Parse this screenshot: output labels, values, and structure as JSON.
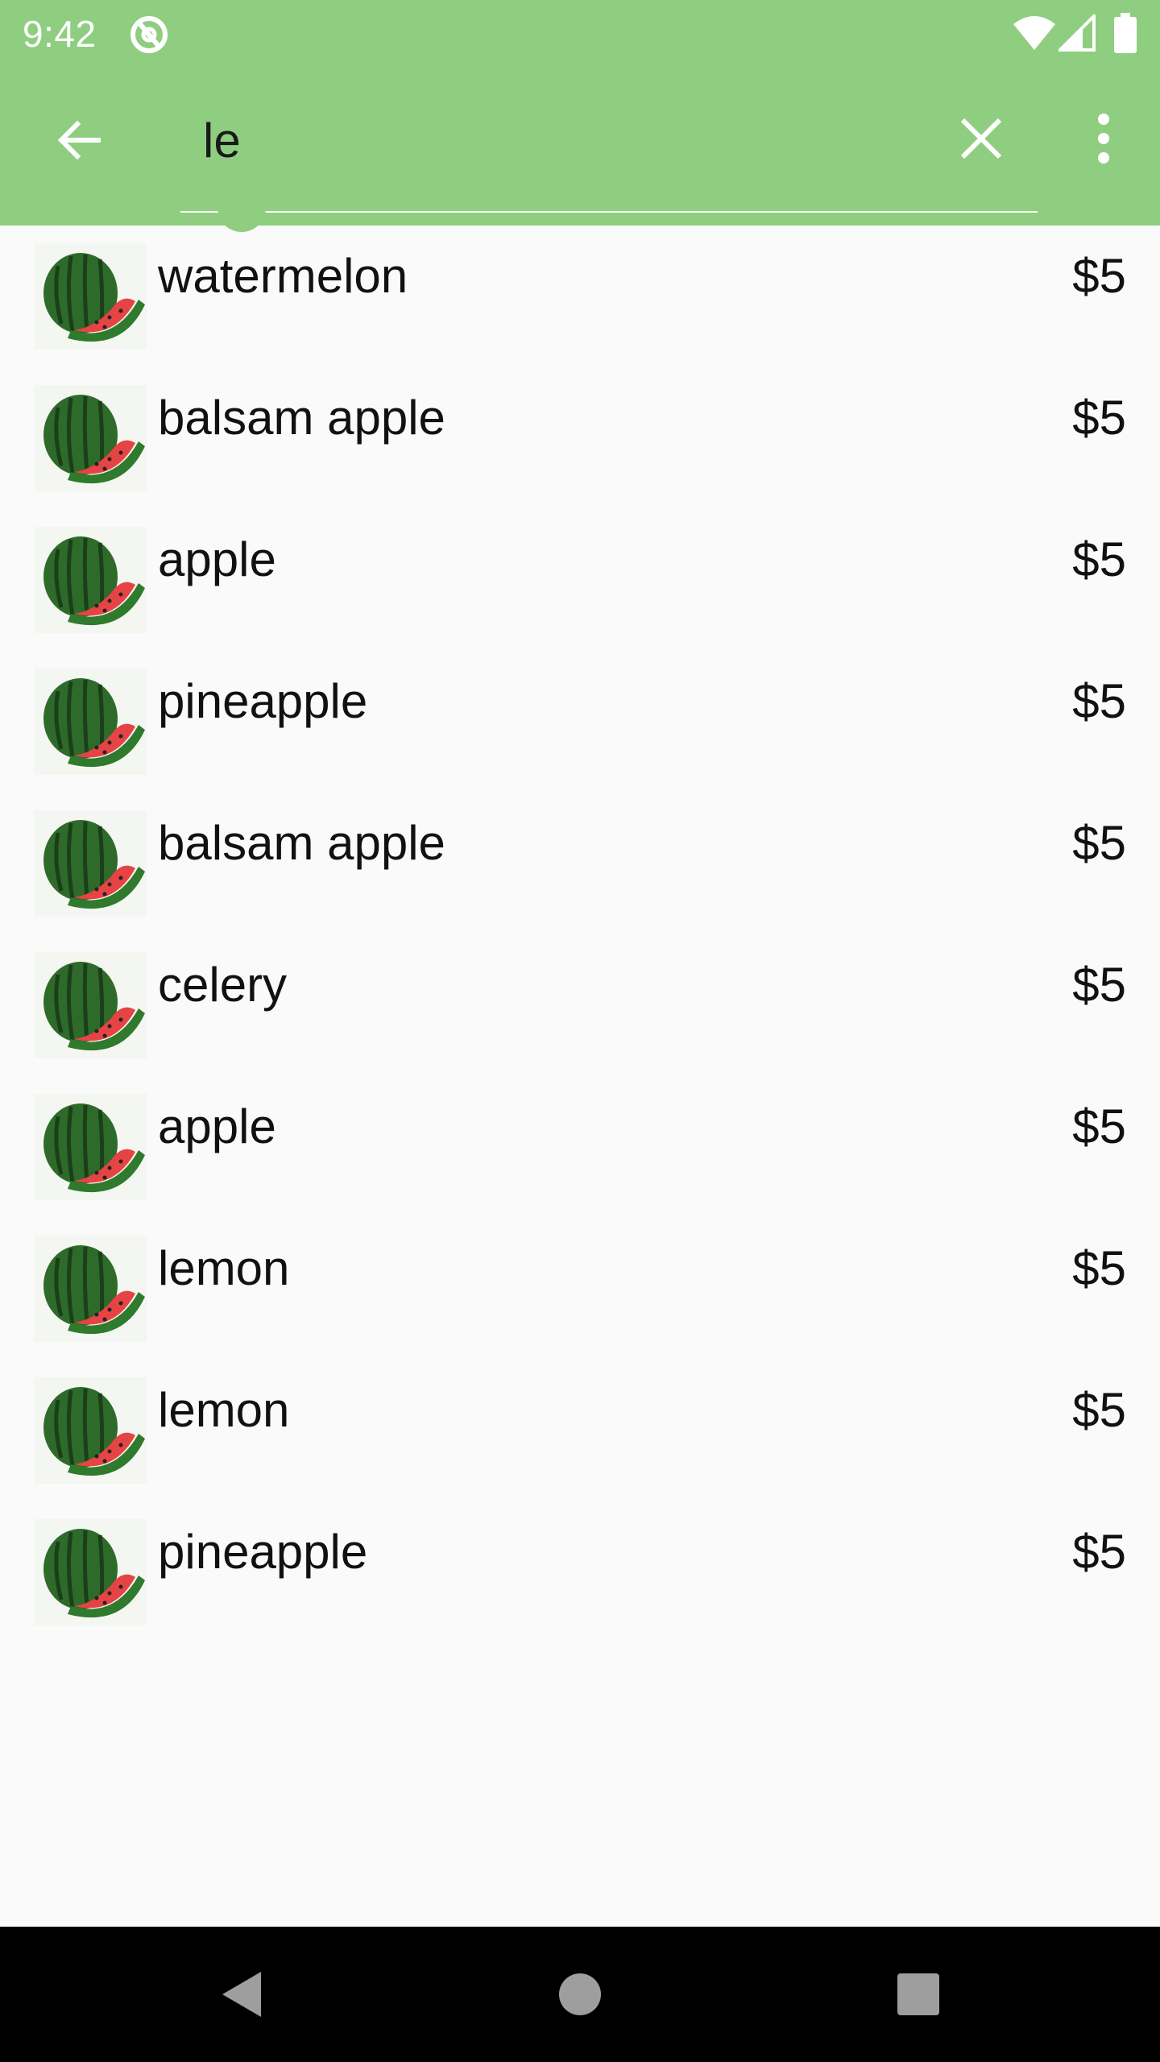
{
  "status_bar": {
    "time": "9:42",
    "icons": [
      "sync-icon",
      "wifi-icon",
      "signal-icon",
      "battery-icon"
    ]
  },
  "search_bar": {
    "back_icon": "arrow-back-icon",
    "query": "le",
    "clear_icon": "close-icon",
    "overflow_icon": "more-vert-icon"
  },
  "colors": {
    "app_bar": "#8fce80",
    "background": "#fafafa",
    "nav_bar": "#000000"
  },
  "products": [
    {
      "name": "watermelon",
      "price": "$5",
      "image": "watermelon-image"
    },
    {
      "name": "balsam apple",
      "price": "$5",
      "image": "watermelon-image"
    },
    {
      "name": "apple",
      "price": "$5",
      "image": "watermelon-image"
    },
    {
      "name": "pineapple",
      "price": "$5",
      "image": "watermelon-image"
    },
    {
      "name": "balsam apple",
      "price": "$5",
      "image": "watermelon-image"
    },
    {
      "name": "celery",
      "price": "$5",
      "image": "watermelon-image"
    },
    {
      "name": "apple",
      "price": "$5",
      "image": "watermelon-image"
    },
    {
      "name": "lemon",
      "price": "$5",
      "image": "watermelon-image"
    },
    {
      "name": "lemon",
      "price": "$5",
      "image": "watermelon-image"
    },
    {
      "name": "pineapple",
      "price": "$5",
      "image": "watermelon-image"
    }
  ],
  "nav_bar": {
    "icons": [
      "nav-back-icon",
      "nav-home-icon",
      "nav-recents-icon"
    ]
  }
}
